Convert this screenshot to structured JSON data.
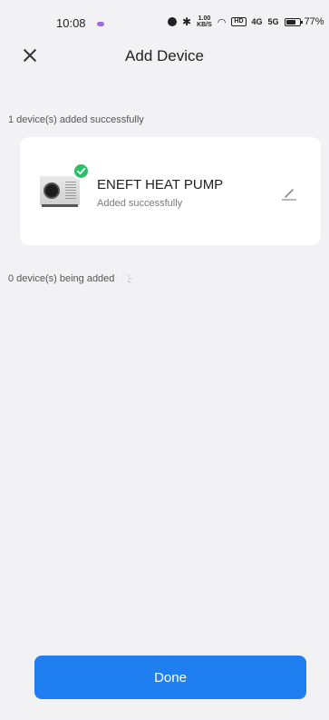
{
  "status_bar": {
    "time": "10:08",
    "speed": "1.00\nKB/S",
    "hd": "HD",
    "signal_1": "4G",
    "signal_2": "5G",
    "battery": "77%",
    "battery_level": 0.77
  },
  "header": {
    "title": "Add Device",
    "close_icon": "close-icon"
  },
  "added_section": {
    "label": "1 device(s) added successfully",
    "devices": [
      {
        "name": "ENEFT HEAT PUMP",
        "status": "Added successfully",
        "badge_color": "#2bbf6a",
        "badge_icon": "check-icon",
        "edit_icon": "pencil-icon"
      }
    ]
  },
  "adding_section": {
    "label": "0 device(s) being added",
    "icon": "spinner-icon"
  },
  "footer": {
    "done_label": "Done",
    "accent_color": "#1f7ff0"
  }
}
